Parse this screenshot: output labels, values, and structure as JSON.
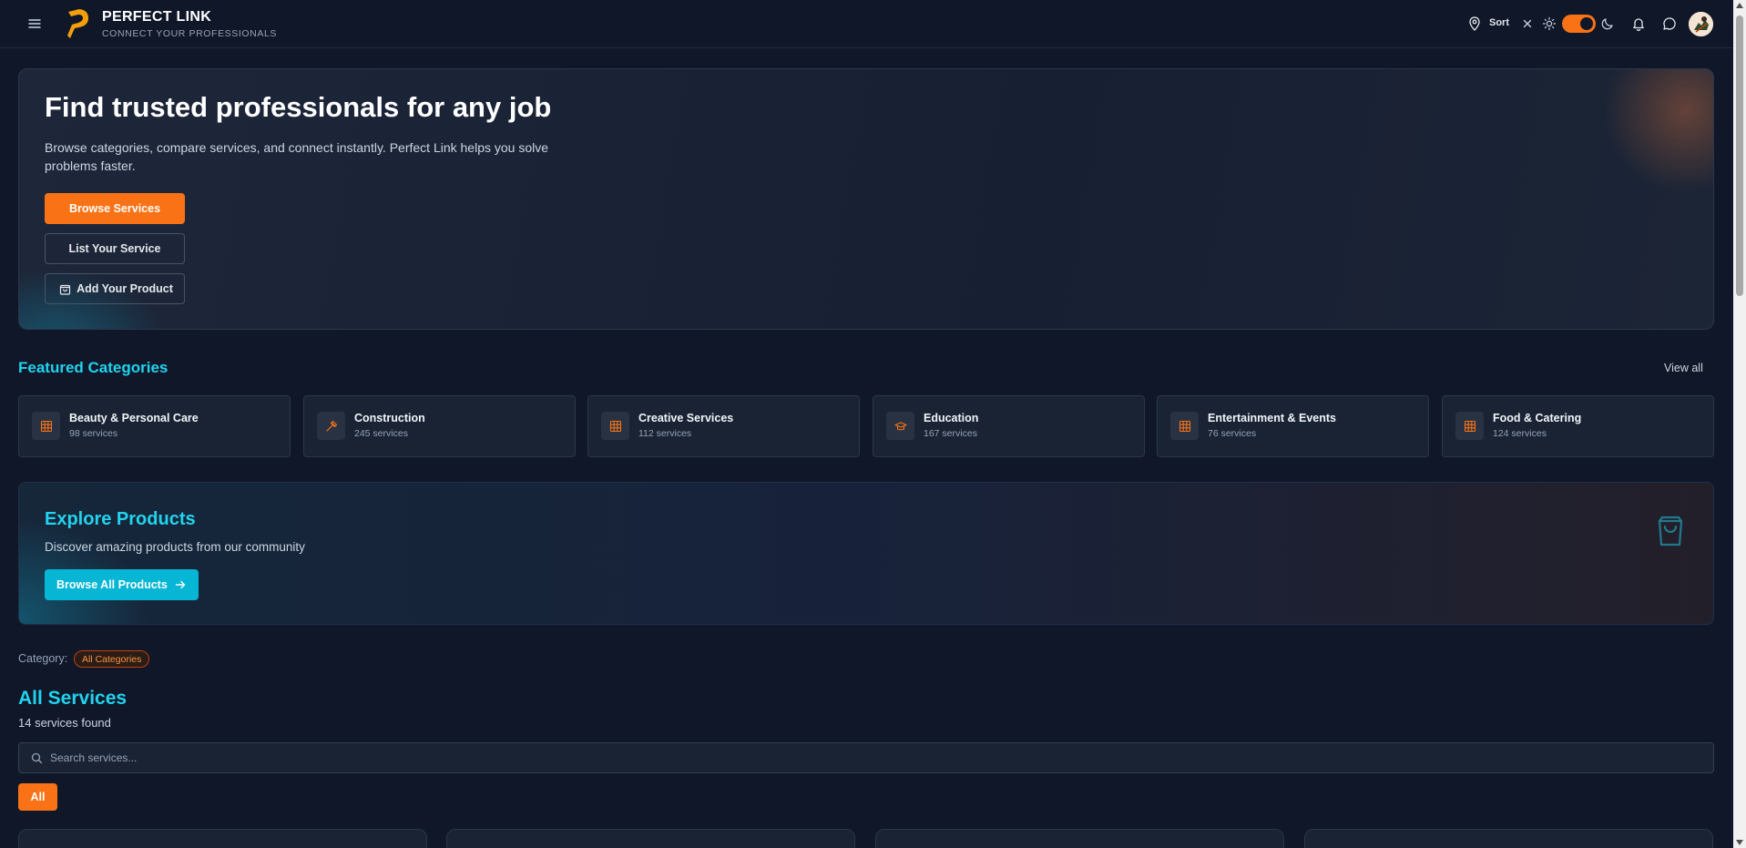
{
  "header": {
    "brand_name": "PERFECT LINK",
    "brand_tagline": "CONNECT YOUR PROFESSIONALS",
    "sort_label": "Sort",
    "theme_toggle_on": true
  },
  "hero": {
    "title": "Find trusted professionals for any job",
    "description": "Browse categories, compare services, and connect instantly. Perfect Link helps you solve problems faster.",
    "browse_services_label": "Browse Services",
    "list_service_label": "List Your Service",
    "add_product_label": "Add Your Product"
  },
  "featured": {
    "title": "Featured Categories",
    "view_all_label": "View all",
    "categories": [
      {
        "name": "Beauty & Personal Care",
        "count": "98 services",
        "icon": "grid-icon"
      },
      {
        "name": "Construction",
        "count": "245 services",
        "icon": "hammer-icon"
      },
      {
        "name": "Creative Services",
        "count": "112 services",
        "icon": "grid-icon"
      },
      {
        "name": "Education",
        "count": "167 services",
        "icon": "graduation-cap-icon"
      },
      {
        "name": "Entertainment & Events",
        "count": "76 services",
        "icon": "grid-icon"
      },
      {
        "name": "Food & Catering",
        "count": "124 services",
        "icon": "grid-icon"
      }
    ]
  },
  "products": {
    "title": "Explore Products",
    "description": "Discover amazing products from our community",
    "button_label": "Browse All Products"
  },
  "filter": {
    "label": "Category:",
    "chip": "All Categories"
  },
  "services": {
    "title": "All Services",
    "count_text": "14 services found",
    "search_placeholder": "Search services...",
    "filter_all_label": "All"
  },
  "colors": {
    "accent_orange": "#f97316",
    "accent_cyan": "#22d3ee",
    "background": "#0f1729"
  }
}
